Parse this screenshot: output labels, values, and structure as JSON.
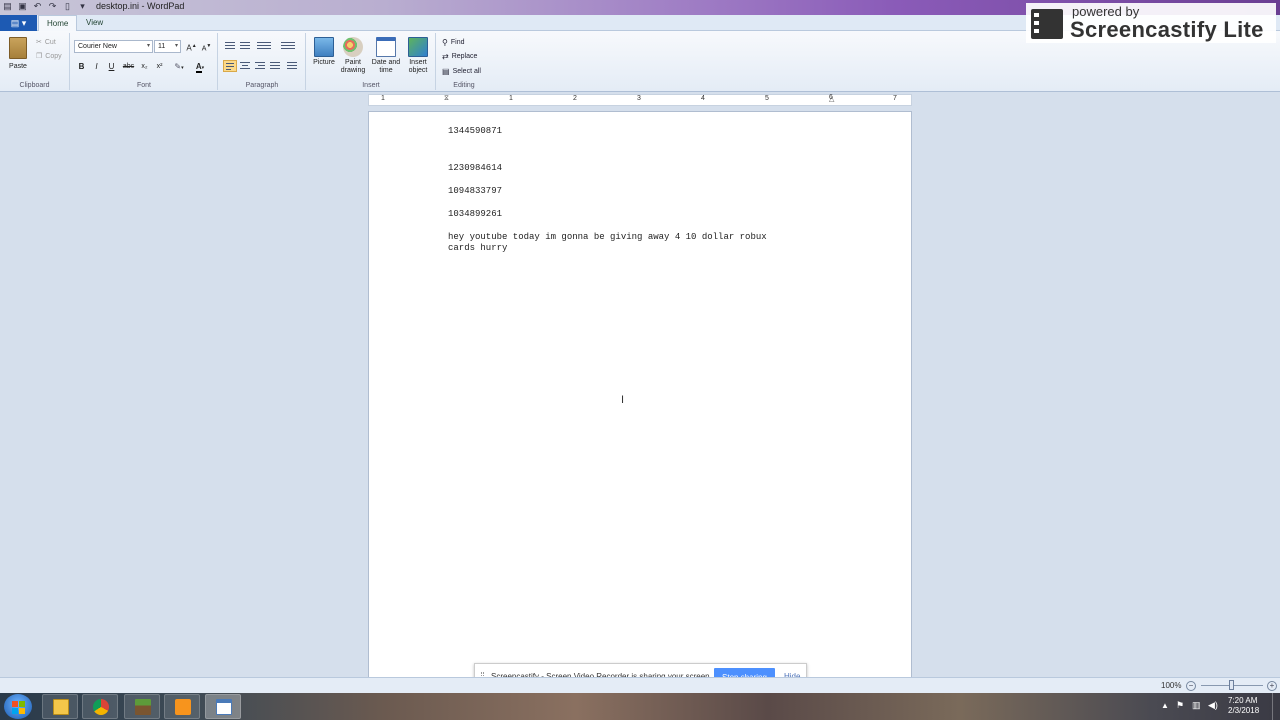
{
  "window": {
    "title": "desktop.ini - WordPad"
  },
  "ribbon": {
    "file_tab": "▤ ▾",
    "tabs": [
      "Home",
      "View"
    ],
    "clipboard": {
      "paste": "Paste",
      "cut": "Cut",
      "copy": "Copy",
      "group": "Clipboard"
    },
    "font": {
      "name": "Courier New",
      "size": "11",
      "group": "Font",
      "bold": "B",
      "italic": "I",
      "underline": "U",
      "strike": "abc",
      "sub": "x₂",
      "sup": "x²"
    },
    "paragraph": {
      "group": "Paragraph"
    },
    "insert": {
      "picture": "Picture",
      "paint_1": "Paint",
      "paint_2": "drawing",
      "date_1": "Date and",
      "date_2": "time",
      "object_1": "Insert",
      "object_2": "object",
      "group": "Insert"
    },
    "editing": {
      "find": "Find",
      "replace": "Replace",
      "select_all": "Select all",
      "group": "Editing"
    }
  },
  "watermark": {
    "powered_by": "powered by",
    "brand": "Screencastify Lite"
  },
  "ruler": {
    "numbers": [
      "1",
      "1",
      "2",
      "3",
      "4",
      "5",
      "6",
      "7"
    ]
  },
  "document": {
    "lines": [
      "1344590871",
      "1230984614",
      "1094833797",
      "1034899261",
      "hey youtube today im gonna be giving away 4 10 dollar robux",
      "cards hurry"
    ]
  },
  "sharebar": {
    "message": "Screencastify - Screen Video Recorder is sharing your screen.",
    "stop": "Stop sharing",
    "hide": "Hide"
  },
  "statusbar": {
    "zoom": "100%",
    "zoom_out": "−",
    "zoom_in": "+"
  },
  "taskbar": {
    "time": "7:20 AM",
    "date": "2/3/2018"
  },
  "colors": {
    "accent": "#1d5ab3",
    "stop_button": "#4d90fe"
  }
}
